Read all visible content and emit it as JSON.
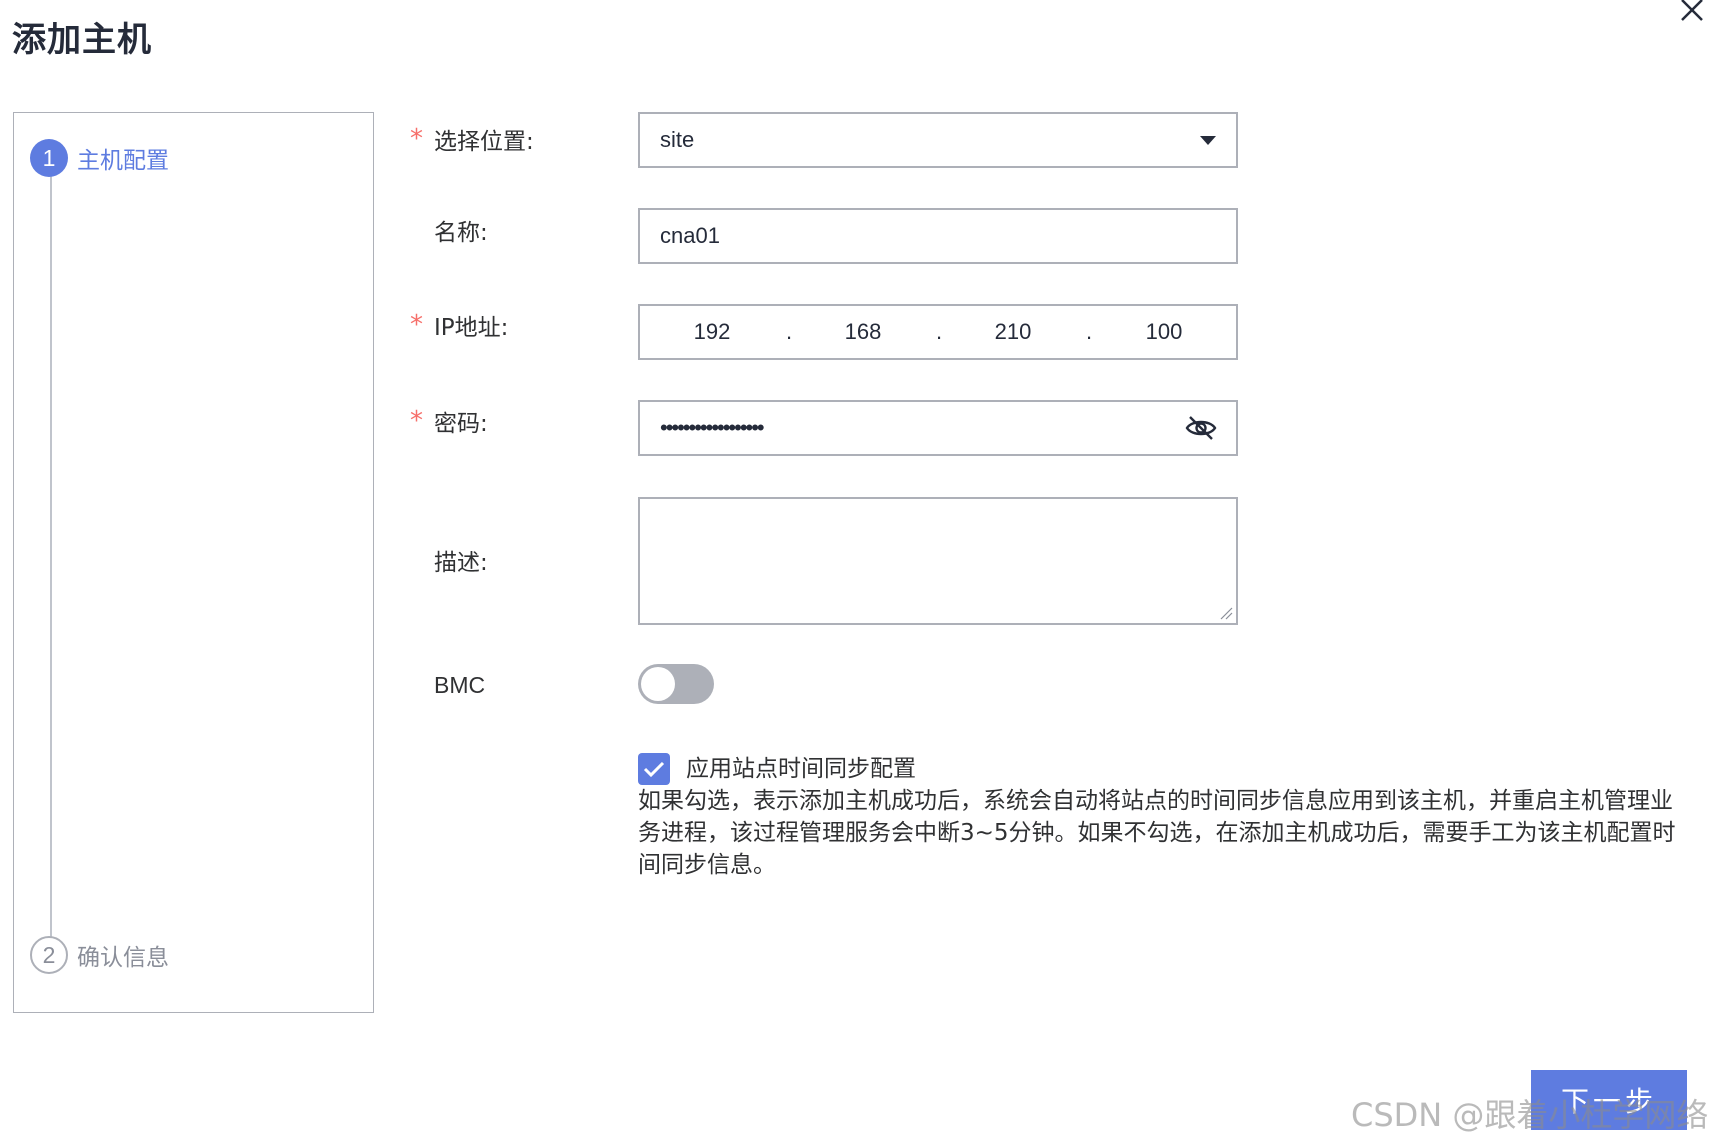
{
  "dialog": {
    "title": "添加主机"
  },
  "steps": [
    {
      "number": "1",
      "label": "主机配置",
      "state": "active"
    },
    {
      "number": "2",
      "label": "确认信息",
      "state": "pending"
    }
  ],
  "form": {
    "required_mark": "*",
    "location": {
      "label": "选择位置:",
      "value": "site"
    },
    "name": {
      "label": "名称:",
      "value": "cna01"
    },
    "ip": {
      "label": "IP地址:",
      "segments": [
        "192",
        "168",
        "210",
        "100"
      ],
      "separator": "."
    },
    "password": {
      "label": "密码:",
      "value": "••••••••••••••••••"
    },
    "description": {
      "label": "描述:",
      "value": ""
    },
    "bmc": {
      "label": "BMC",
      "enabled": false
    },
    "time_sync": {
      "checked": true,
      "label": "应用站点时间同步配置",
      "help": "如果勾选，表示添加主机成功后，系统会自动将站点的时间同步信息应用到该主机，并重启主机管理业务进程，该过程管理服务会中断3~5分钟。如果不勾选，在添加主机成功后，需要手工为该主机配置时间同步信息。"
    }
  },
  "footer": {
    "next_label": "下一步"
  },
  "watermark": "CSDN @跟着小杜学网络",
  "colors": {
    "accent": "#5e7ce0",
    "required": "#f66f6a",
    "border": "#adb0b8"
  }
}
